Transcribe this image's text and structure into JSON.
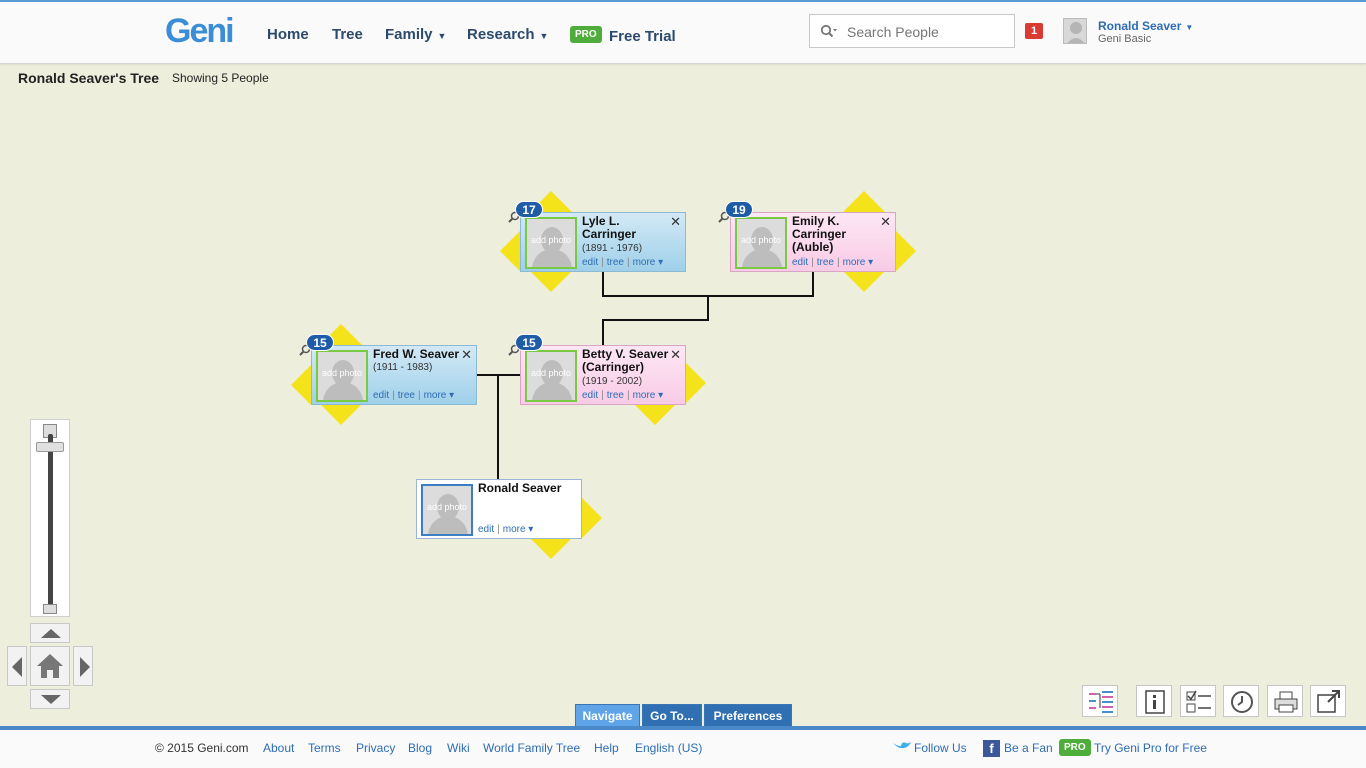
{
  "header": {
    "logo": "Geni",
    "nav": [
      {
        "label": "Home"
      },
      {
        "label": "Tree"
      },
      {
        "label": "Family",
        "dropdown": true
      },
      {
        "label": "Research",
        "dropdown": true
      }
    ],
    "pro_badge": "PRO",
    "free_trial": "Free Trial",
    "search_placeholder": "Search People",
    "notification_count": "1",
    "user_name": "Ronald Seaver",
    "user_plan": "Geni Basic"
  },
  "tree": {
    "title": "Ronald Seaver's Tree",
    "subtitle": "Showing 5 People"
  },
  "people": {
    "lyle": {
      "name": "Lyle L. Carringer",
      "dates": "(1891 - 1976)",
      "count": "17",
      "gender": "male"
    },
    "emily": {
      "name": "Emily K. Carringer (Auble)",
      "dates": "",
      "count": "19",
      "gender": "female"
    },
    "fred": {
      "name": "Fred W. Seaver",
      "dates": "(1911 - 1983)",
      "count": "15",
      "gender": "male"
    },
    "betty": {
      "name": "Betty V. Seaver (Carringer)",
      "dates": "(1919 - 2002)",
      "count": "15",
      "gender": "female"
    },
    "ronald": {
      "name": "Ronald Seaver",
      "dates": ""
    }
  },
  "card_labels": {
    "add_photo": "add photo",
    "edit": "edit",
    "tree": "tree",
    "more": "more ▾",
    "close": "✕"
  },
  "tabs": [
    "Navigate",
    "Go To...",
    "Preferences"
  ],
  "tools": [
    "tree-view-icon",
    "info-icon",
    "checklist-icon",
    "history-icon",
    "print-icon",
    "open-external-icon"
  ],
  "footer": {
    "copyright": "© 2015 Geni.com",
    "links": [
      "About",
      "Terms",
      "Privacy",
      "Blog",
      "Wiki",
      "World Family Tree",
      "Help",
      "English (US)"
    ],
    "follow": "Follow Us",
    "fan": "Be a Fan",
    "pro_badge": "PRO",
    "pro_text": "Try Geni Pro for Free"
  },
  "colors": {
    "accent": "#2e6db4",
    "male_card": "#bfe0f1",
    "female_card": "#fbd9ee",
    "arrow": "#f4e21a",
    "background": "#eeeedd"
  }
}
